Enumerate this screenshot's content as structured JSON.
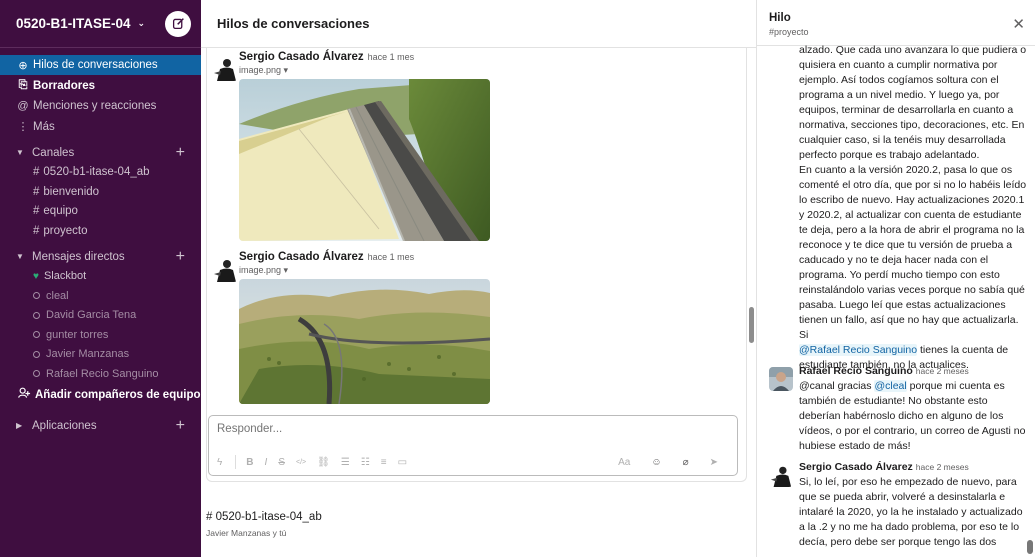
{
  "workspace": {
    "name": "0520-B1-ITASE-04",
    "chevron": "⌄"
  },
  "sidebar": {
    "nav": [
      {
        "label": "Hilos de conversaciones",
        "icon": "threads-icon",
        "glyph": "⊕",
        "active": true,
        "bold": false
      },
      {
        "label": "Borradores",
        "icon": "drafts-icon",
        "glyph": "⎘",
        "active": false,
        "bold": true
      },
      {
        "label": "Menciones y reacciones",
        "icon": "at-icon",
        "glyph": "@",
        "active": false,
        "bold": false
      },
      {
        "label": "Más",
        "icon": "more-vertical-icon",
        "glyph": "⋮",
        "active": false,
        "bold": false
      }
    ],
    "channels_title": "Canales",
    "channels": [
      "0520-b1-itase-04_ab",
      "bienvenido",
      "equipo",
      "proyecto"
    ],
    "dms_title": "Mensajes directos",
    "dms": [
      {
        "name": "Slackbot",
        "status": "heart"
      },
      {
        "name": "cleal",
        "status": "away"
      },
      {
        "name": "David Garcia Tena",
        "status": "away"
      },
      {
        "name": "gunter torres",
        "status": "away"
      },
      {
        "name": "Javier Manzanas",
        "status": "away"
      },
      {
        "name": "Rafael Recio Sanguino",
        "status": "away"
      }
    ],
    "add_team": "Añadir compañeros de equipo",
    "apps_title": "Aplicaciones"
  },
  "main": {
    "title": "Hilos de conversaciones",
    "messages": [
      {
        "author": "Sergio Casado Álvarez",
        "time": "hace 1 mes",
        "file": "image.png"
      },
      {
        "author": "Sergio Casado Álvarez",
        "time": "hace 1 mes",
        "file": "image.png"
      }
    ],
    "composer_placeholder": "Responder...",
    "composer_format_label": "Aa",
    "footer_channel": "# 0520-b1-itase-04_ab",
    "footer_members": "Javier Manzanas y tú"
  },
  "thread": {
    "title": "Hilo",
    "channel": "#proyecto",
    "msg1_lines": [
      "alzado. Que cada uno avanzara lo que pudiera o",
      "quisiera en cuanto a cumplir normativa por",
      "ejemplo. Así todos cogíamos soltura con el",
      "programa a un nivel medio. Y luego ya, por",
      "equipos, terminar de desarrollarla en cuanto a",
      "normativa, secciones tipo, decoraciones, etc. En",
      "cualquier caso, si la tenéis muy desarrollada",
      "perfecto porque es trabajo adelantado.",
      "En cuanto a la versión 2020.2, pasa lo que os",
      "comenté el otro día, que por si no lo habéis leído",
      "lo escribo de nuevo. Hay actualizaciones 2020.1",
      "y 2020.2, al actualizar con cuenta de estudiante",
      "te deja, pero a la hora de abrir el programa no la",
      "reconoce y te dice que tu versión de prueba a",
      "caducado y no te deja hacer nada con el",
      "programa. Yo perdí mucho tiempo con esto",
      "reinstalándolo varias veces porque no sabía qué",
      "pasaba. Luego leí que estas actualizaciones",
      "tienen un fallo, así que no hay que actualizarla. Si"
    ],
    "msg1_mention": "@Rafael Recio Sanguino",
    "msg1_after_mention": " tienes la cuenta de",
    "msg1_last": "estudiante también, no la actualices.",
    "msg2": {
      "author": "Rafael Recio Sanguino",
      "time": "hace 2 meses",
      "line1_pre": "@canal gracias ",
      "line1_mention": "@cleal",
      "line1_post": " porque mi cuenta es",
      "lines": [
        "también de estudiante! No obstante esto",
        "deberían habérnoslo dicho en alguno de los",
        "vídeos, o por el contrario, un correo de Agusti no",
        "hubiese estado de más!"
      ]
    },
    "msg3": {
      "author": "Sergio Casado Álvarez",
      "time": "hace 2 meses",
      "lines": [
        "Si, lo leí, por eso he empezado de nuevo, para",
        "que se pueda abrir, volveré a desinstalarla e",
        "intalaré la 2020, yo la he instalado y actualizado",
        "a la .2 y no me ha dado problema, por eso te lo",
        "decía, pero debe ser porque tengo las dos"
      ]
    }
  }
}
